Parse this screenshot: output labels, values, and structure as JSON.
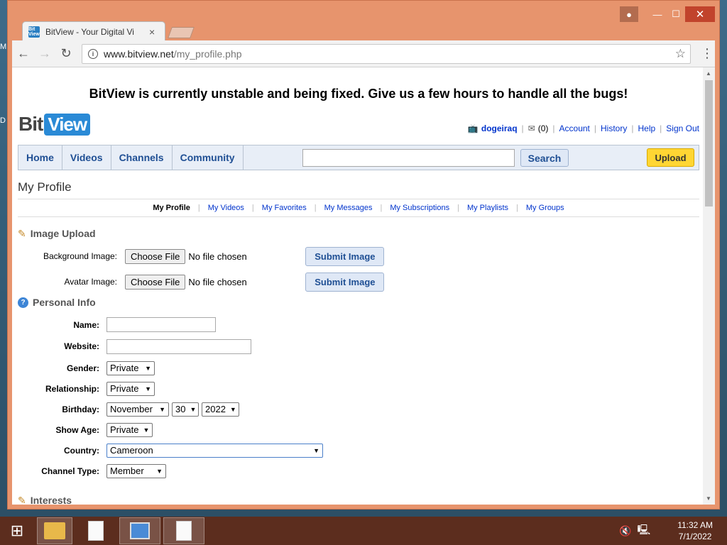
{
  "desktop": {
    "letter_top": "M",
    "letter_mid": "D"
  },
  "window": {
    "tab_title": "BitView - Your Digital Vi",
    "favicon_text": "Bit View"
  },
  "toolbar": {
    "url_host": "www.bitview.net",
    "url_path": "/my_profile.php"
  },
  "page": {
    "banner": "BitView is currently unstable and being fixed. Give us a few hours to handle all the bugs!",
    "logo": {
      "bit": "Bit",
      "view": "View"
    },
    "userbar": {
      "username": "dogeiraq",
      "messages": "(0)",
      "links": [
        "Account",
        "History",
        "Help",
        "Sign Out"
      ]
    },
    "nav": {
      "links": [
        "Home",
        "Videos",
        "Channels",
        "Community"
      ],
      "search_label": "Search",
      "upload_label": "Upload"
    },
    "title": "My Profile",
    "subnav": [
      "My Profile",
      "My Videos",
      "My Favorites",
      "My Messages",
      "My Subscriptions",
      "My Playlists",
      "My Groups"
    ],
    "image_upload": {
      "title": "Image Upload",
      "rows": [
        {
          "label": "Background Image:",
          "choose": "Choose File",
          "status": "No file chosen",
          "submit": "Submit Image"
        },
        {
          "label": "Avatar Image:",
          "choose": "Choose File",
          "status": "No file chosen",
          "submit": "Submit Image"
        }
      ]
    },
    "personal_info": {
      "title": "Personal Info",
      "name_label": "Name:",
      "name_value": "",
      "website_label": "Website:",
      "website_value": "",
      "gender_label": "Gender:",
      "gender_value": "Private",
      "relationship_label": "Relationship:",
      "relationship_value": "Private",
      "birthday_label": "Birthday:",
      "birthday_month": "November",
      "birthday_day": "30",
      "birthday_year": "2022",
      "showage_label": "Show Age:",
      "showage_value": "Private",
      "country_label": "Country:",
      "country_value": "Cameroon",
      "channeltype_label": "Channel Type:",
      "channeltype_value": "Member"
    },
    "interests_title": "Interests"
  },
  "taskbar": {
    "time": "11:32 AM",
    "date": "7/1/2022"
  },
  "colors": {
    "accent": "#1f4f94",
    "upload": "#ffd633",
    "window_frame": "#e7946d",
    "taskbar": "#5c2d1e"
  }
}
